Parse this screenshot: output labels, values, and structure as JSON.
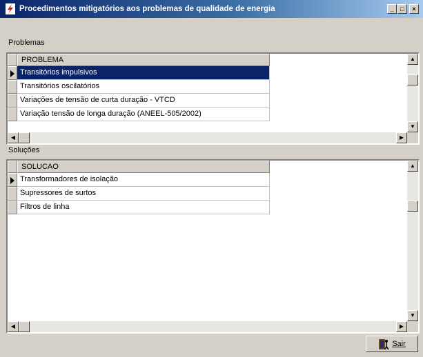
{
  "window": {
    "title": "Procedimentos mitigatórios aos problemas de qualidade de energia",
    "controls": {
      "minimize": "_",
      "maximize": "□",
      "close": "×"
    }
  },
  "problems": {
    "label": "Problemas",
    "column_header": "PROBLEMA",
    "rows": [
      "Transitórios impulsivos",
      "Transitórios oscilatórios",
      "Variações de tensão de curta duração - VTCD",
      "Variação tensão de longa duração (ANEEL-505/2002)"
    ],
    "selected_index": 0
  },
  "solutions": {
    "label": "Soluções",
    "column_header": "SOLUCAO",
    "rows": [
      "Transformadores de isolação",
      "Supressores de surtos",
      "Filtros de linha"
    ],
    "current_index": 0
  },
  "footer": {
    "exit_label": "Sair"
  },
  "colors": {
    "title_start": "#0a246a",
    "title_end": "#a6caf0",
    "selection": "#0a246a",
    "face": "#d4d0c8"
  }
}
